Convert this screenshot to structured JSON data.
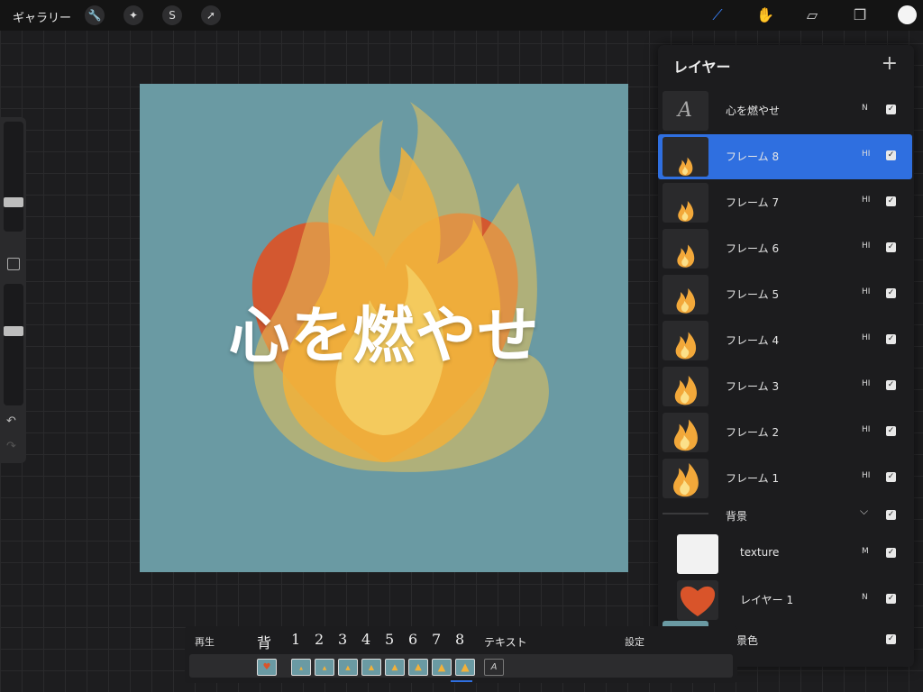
{
  "topbar": {
    "gallery_label": "ギャラリー",
    "left_tools": [
      "wrench-icon",
      "magic-wand-icon",
      "selection-icon",
      "transform-arrow-icon"
    ],
    "right_tools": [
      "brush-icon",
      "smudge-icon",
      "eraser-icon",
      "layers-icon"
    ],
    "color": "#f4f4f4"
  },
  "sidebar": {
    "brush_size": 0.24,
    "opacity": 0.62
  },
  "canvas": {
    "text": "心を燃やせ",
    "background": "#6a9aa3"
  },
  "layers_panel": {
    "title": "レイヤー",
    "add_label": "+",
    "layers": [
      {
        "name": "心を燃やせ",
        "mode": "N",
        "checked": true,
        "thumb": "text-a-icon"
      },
      {
        "name": "フレーム 8",
        "mode": "HI",
        "checked": true,
        "selected": true
      },
      {
        "name": "フレーム 7",
        "mode": "HI",
        "checked": true
      },
      {
        "name": "フレーム 6",
        "mode": "HI",
        "checked": true
      },
      {
        "name": "フレーム 5",
        "mode": "HI",
        "checked": true
      },
      {
        "name": "フレーム 4",
        "mode": "HI",
        "checked": true
      },
      {
        "name": "フレーム 3",
        "mode": "HI",
        "checked": true
      },
      {
        "name": "フレーム 2",
        "mode": "HI",
        "checked": true
      },
      {
        "name": "フレーム 1",
        "mode": "HI",
        "checked": true
      }
    ],
    "group": {
      "name": "背景",
      "checked": true
    },
    "group_children": [
      {
        "name": "texture",
        "mode": "M",
        "checked": true
      },
      {
        "name": "レイヤー 1",
        "mode": "N",
        "checked": true
      }
    ],
    "background_color": {
      "name": "背景色",
      "checked": true,
      "color": "#6a9aa3"
    }
  },
  "timeline": {
    "play_label": "再生",
    "settings_label": "設定",
    "frame_labels": [
      "背",
      "1",
      "2",
      "3",
      "4",
      "5",
      "6",
      "7",
      "8",
      "テキスト"
    ],
    "text_frame_glyph": "A"
  }
}
